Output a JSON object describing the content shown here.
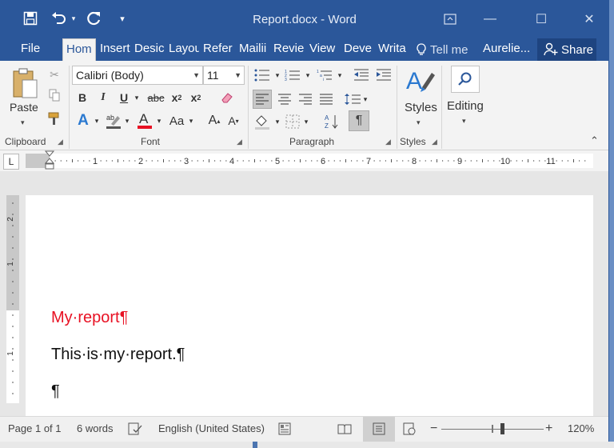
{
  "window": {
    "title": "Report.docx - Word",
    "qat": {
      "save_icon": "save-icon",
      "undo_icon": "undo-icon",
      "redo_icon": "redo-icon"
    },
    "controls": {
      "restore_icon": "ribbon-display-icon",
      "minimize": "—",
      "maximize": "☐",
      "close": "✕"
    }
  },
  "tabs": [
    {
      "label": "File"
    },
    {
      "label": "Hom",
      "active": true
    },
    {
      "label": "Insert"
    },
    {
      "label": "Desic"
    },
    {
      "label": "Layou"
    },
    {
      "label": "Refer"
    },
    {
      "label": "Mailii"
    },
    {
      "label": "Revie"
    },
    {
      "label": "View"
    },
    {
      "label": "Deve"
    },
    {
      "label": "Writa"
    }
  ],
  "tell_me": "Tell me",
  "user": "Aurelie...",
  "share": "Share",
  "ribbon": {
    "clipboard": {
      "paste": "Paste",
      "label": "Clipboard"
    },
    "font": {
      "name": "Calibri (Body)",
      "size": "11",
      "label": "Font",
      "bold": "B",
      "italic": "I",
      "underline": "U",
      "strike": "abc",
      "subscript": "x",
      "superscript": "x"
    },
    "paragraph": {
      "label": "Paragraph",
      "pilcrow": "¶"
    },
    "styles": {
      "button": "Styles",
      "label": "Styles"
    },
    "editing": {
      "button": "Editing"
    }
  },
  "ruler": {
    "corner": "L",
    "numbers": [
      "1",
      "2",
      "3",
      "4",
      "5",
      "6",
      "7",
      "8",
      "9",
      "10",
      "11"
    ],
    "vnumbers": [
      "2",
      "1",
      "1"
    ]
  },
  "document": {
    "heading": "My·report¶",
    "body": "This·is·my·report.¶",
    "empty": "¶",
    "heading_color": "#e81123"
  },
  "status": {
    "page": "Page 1 of 1",
    "words": "6 words",
    "language": "English (United States)",
    "zoom": "120%",
    "zoom_level": 0.6
  },
  "colors": {
    "accent": "#2b579a",
    "font_color_bar": "#e81123"
  }
}
